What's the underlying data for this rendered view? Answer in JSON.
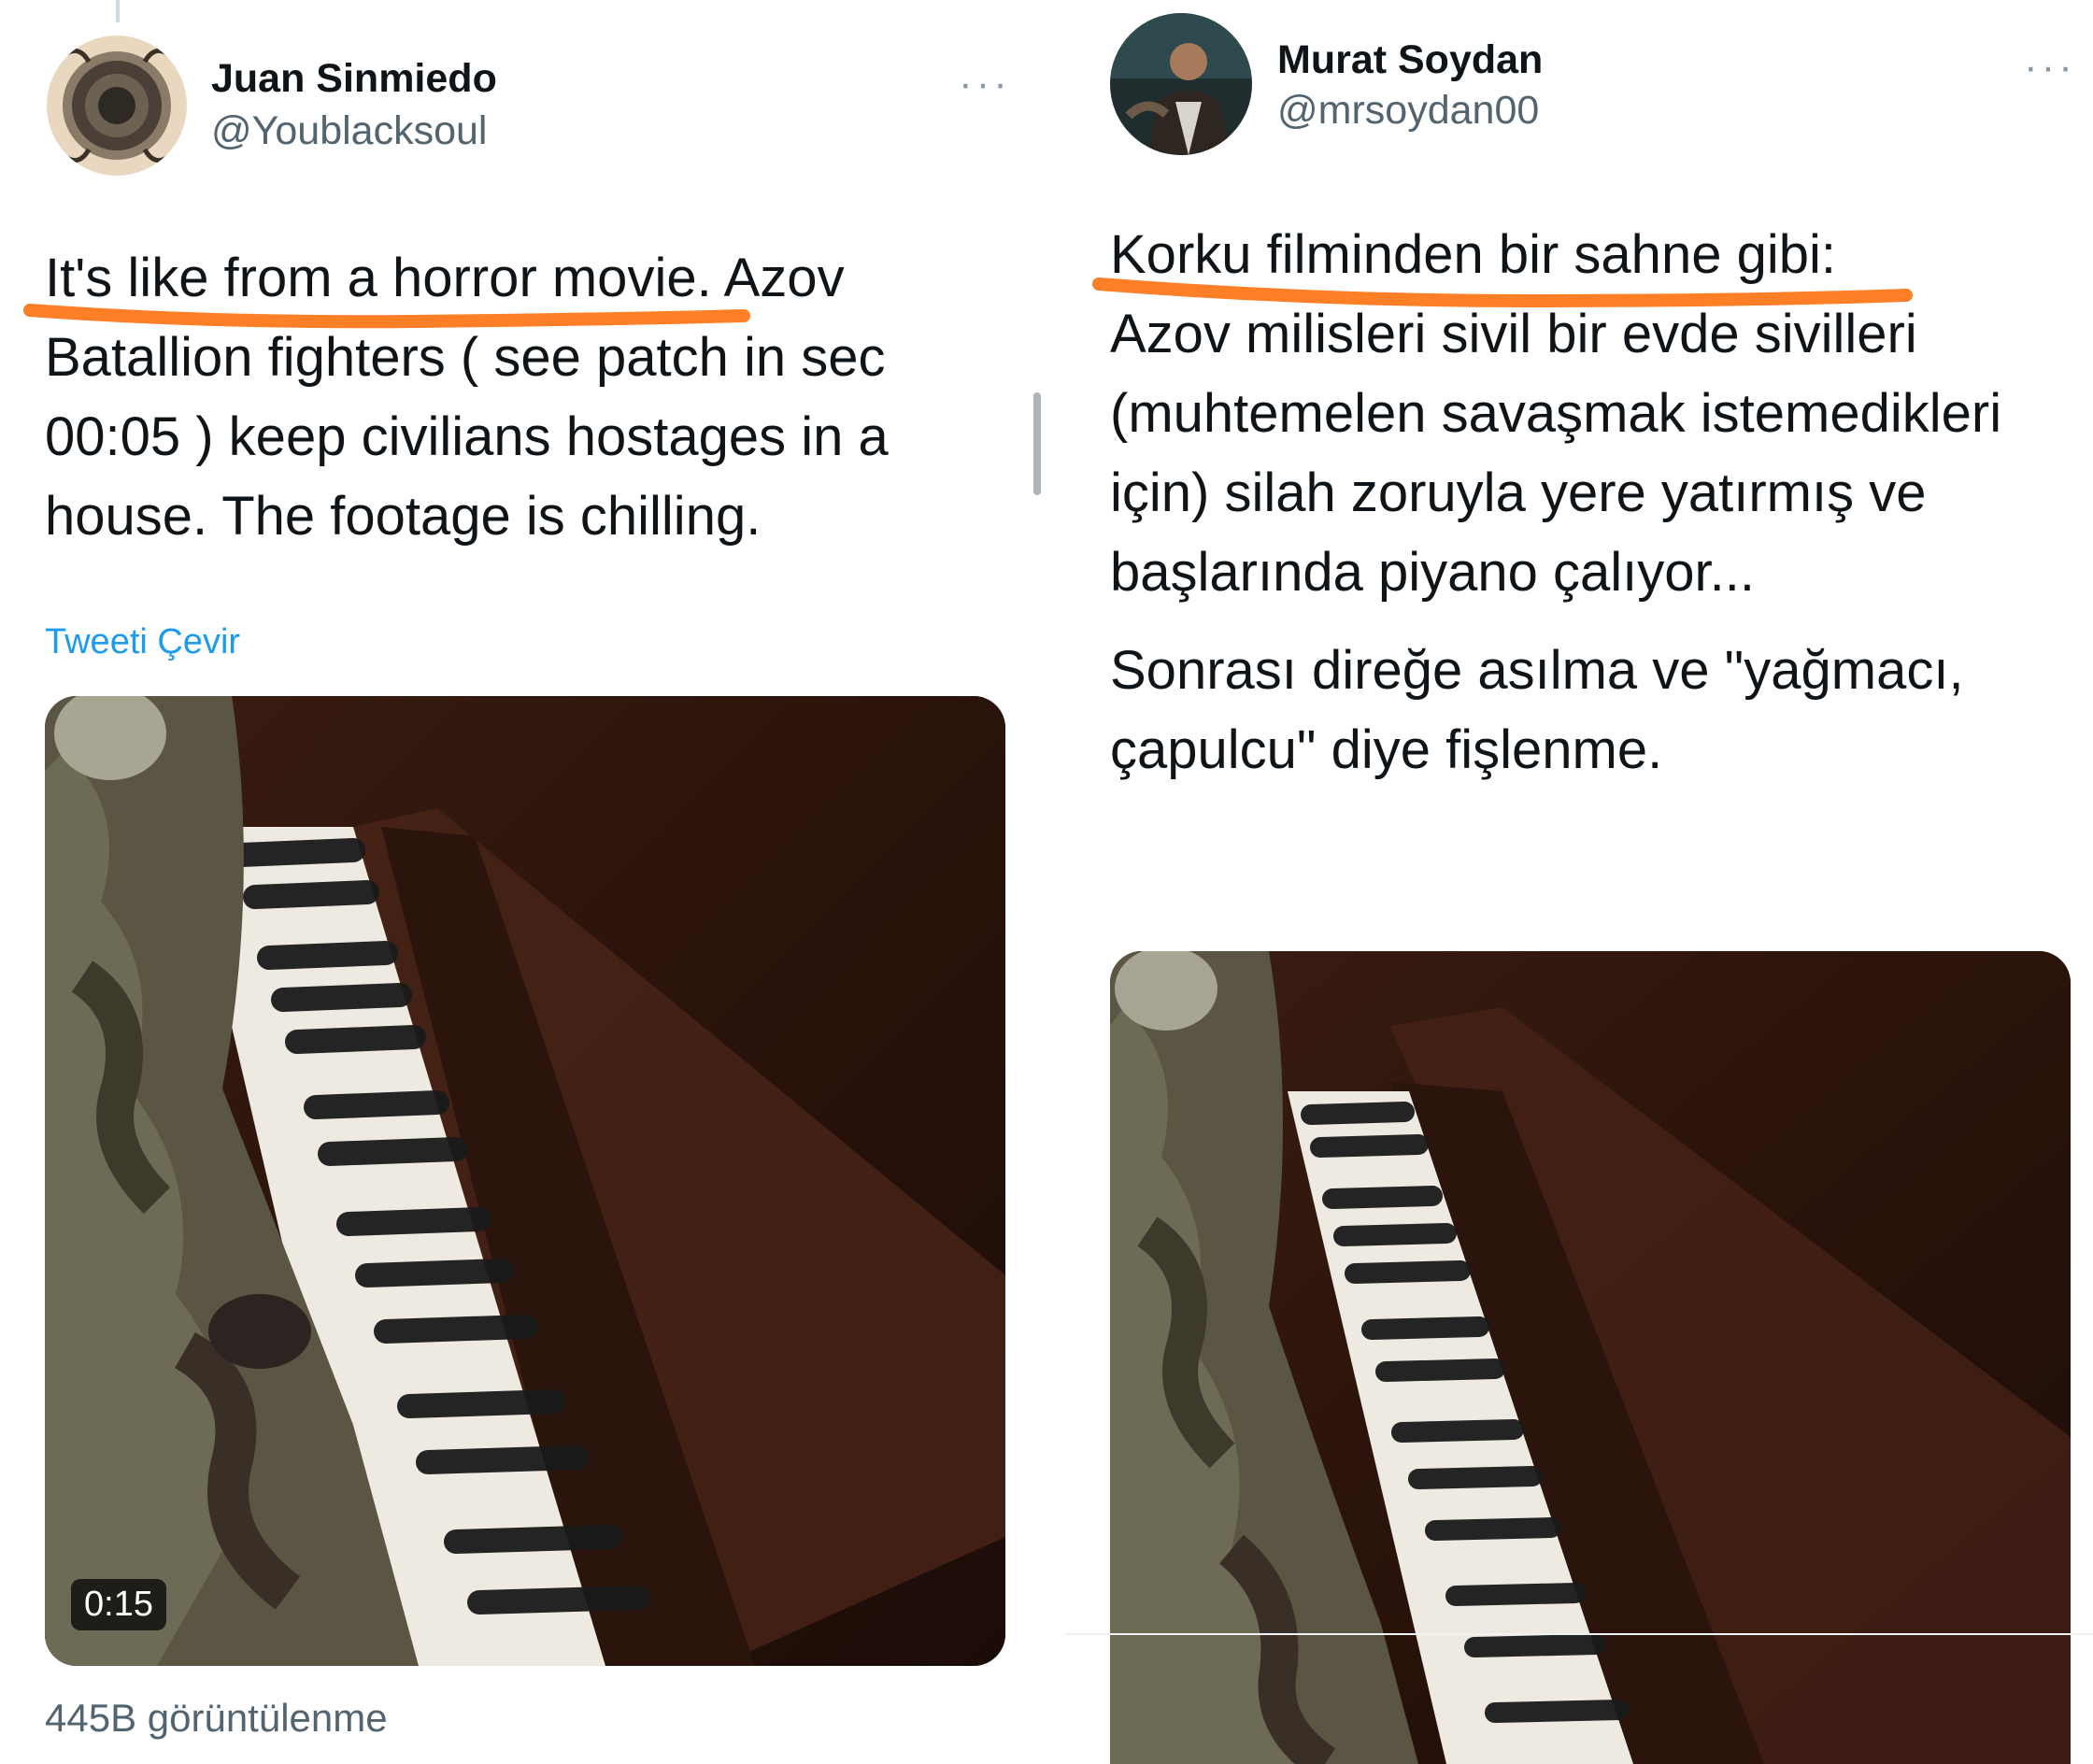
{
  "left_tweet": {
    "display_name": "Juan Sinmiedo",
    "handle": "@Youblacksoul",
    "more_label": "···",
    "text_highlight": "It's like from a horror movie",
    "text_rest": ". Azov Batallion fighters ( see patch in sec 00:05 ) keep civilians hostages in a house. The footage is chilling.",
    "translate_label": "Tweeti Çevir",
    "video_duration": "0:15",
    "views": "445B görüntülenme"
  },
  "right_tweet": {
    "display_name": "Murat Soydan",
    "handle": "@mrsoydan00",
    "more_label": "···",
    "text_highlight": "Korku filminden bir sahne gibi:",
    "text_body": "Azov milisleri sivil bir evde sivilleri (muhtemelen savaşmak istemedikleri için) silah zoruyla yere yatırmış ve başlarında piyano çalıyor...",
    "text_second": "Sonrası direğe asılma ve \"yağmacı, çapulcu\" diye fişlenme."
  },
  "colors": {
    "underline": "#ff7f27",
    "link": "#1d9bf0",
    "secondary_text": "#536471"
  },
  "icons": [
    "avatar-illustration",
    "avatar-photo",
    "more-options-icon"
  ]
}
